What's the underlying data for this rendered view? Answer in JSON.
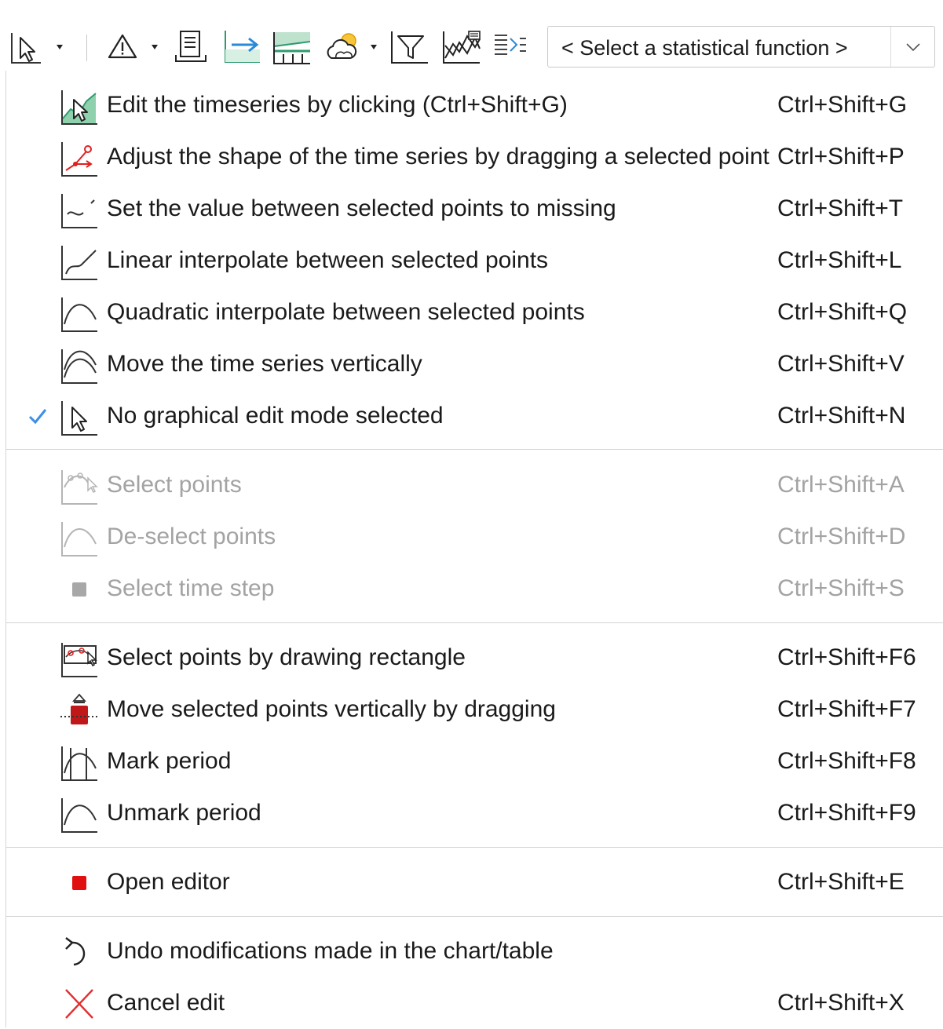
{
  "toolbar": {
    "icons": [
      "pointer-mode-icon",
      "warning-flag-icon",
      "document-icon",
      "import-arrow-icon",
      "threshold-chart-icon",
      "weather-icon",
      "filter-icon",
      "series-overlay-icon",
      "text-align-icon"
    ],
    "select": {
      "value": "< Select a statistical function >"
    }
  },
  "menu": {
    "items": [
      {
        "label": "Edit the timeseries by clicking (Ctrl+Shift+G)",
        "shortcut": "Ctrl+Shift+G",
        "icon": "edit-click-icon",
        "enabled": true
      },
      {
        "label": "Adjust the shape of the time series by dragging a selected point",
        "shortcut": "Ctrl+Shift+P",
        "icon": "drag-point-icon",
        "enabled": true
      },
      {
        "label": "Set the value between selected points to missing",
        "shortcut": "Ctrl+Shift+T",
        "icon": "missing-value-icon",
        "enabled": true
      },
      {
        "label": "Linear interpolate between selected points",
        "shortcut": "Ctrl+Shift+L",
        "icon": "linear-interpolate-icon",
        "enabled": true
      },
      {
        "label": "Quadratic interpolate between selected points",
        "shortcut": "Ctrl+Shift+Q",
        "icon": "quadratic-interpolate-icon",
        "enabled": true
      },
      {
        "label": "Move the time series vertically",
        "shortcut": "Ctrl+Shift+V",
        "icon": "move-vertical-icon",
        "enabled": true
      },
      {
        "label": "No graphical edit mode selected",
        "shortcut": "Ctrl+Shift+N",
        "icon": "pointer-icon",
        "enabled": true,
        "checked": true
      },
      {
        "label": "Select points",
        "shortcut": "Ctrl+Shift+A",
        "icon": "select-points-icon",
        "enabled": false
      },
      {
        "label": "De-select points",
        "shortcut": "Ctrl+Shift+D",
        "icon": "deselect-points-icon",
        "enabled": false
      },
      {
        "label": "Select time step",
        "shortcut": "Ctrl+Shift+S",
        "icon": "time-step-icon",
        "enabled": false
      },
      {
        "label": "Select points by drawing rectangle",
        "shortcut": "Ctrl+Shift+F6",
        "icon": "rectangle-select-icon",
        "enabled": true
      },
      {
        "label": "Move selected points vertically by dragging",
        "shortcut": "Ctrl+Shift+F7",
        "icon": "move-points-icon",
        "enabled": true
      },
      {
        "label": "Mark period",
        "shortcut": "Ctrl+Shift+F8",
        "icon": "mark-period-icon",
        "enabled": true
      },
      {
        "label": "Unmark period",
        "shortcut": "Ctrl+Shift+F9",
        "icon": "unmark-period-icon",
        "enabled": true
      },
      {
        "label": "Open editor",
        "shortcut": "Ctrl+Shift+E",
        "icon": "open-editor-icon",
        "enabled": true
      },
      {
        "label": "Undo modifications made in the chart/table",
        "shortcut": "",
        "icon": "undo-icon",
        "enabled": true
      },
      {
        "label": "Cancel edit",
        "shortcut": "Ctrl+Shift+X",
        "icon": "cancel-icon",
        "enabled": true
      }
    ]
  },
  "colors": {
    "check": "#3c8fe6",
    "accent_green": "#2e9b6e",
    "red": "#e01010",
    "disabled_text": "#a3a3a3"
  }
}
